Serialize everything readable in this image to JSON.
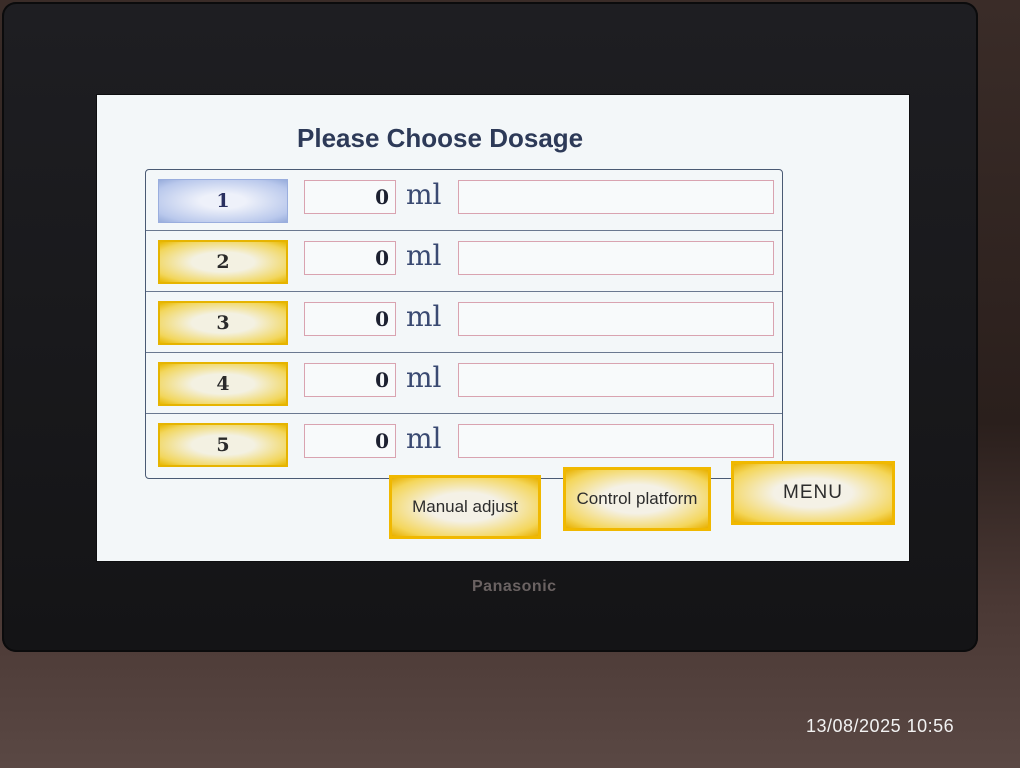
{
  "device": {
    "brand": "Panasonic"
  },
  "screen": {
    "title": "Please Choose Dosage",
    "rows": [
      {
        "number": "1",
        "value": "0",
        "unit": "ml",
        "name": "",
        "selected": true
      },
      {
        "number": "2",
        "value": "0",
        "unit": "ml",
        "name": "",
        "selected": false
      },
      {
        "number": "3",
        "value": "0",
        "unit": "ml",
        "name": "",
        "selected": false
      },
      {
        "number": "4",
        "value": "0",
        "unit": "ml",
        "name": "",
        "selected": false
      },
      {
        "number": "5",
        "value": "0",
        "unit": "ml",
        "name": "",
        "selected": false
      }
    ],
    "buttons": {
      "manual_adjust": "Manual adjust",
      "control_platform": "Control platform",
      "menu": "MENU"
    }
  },
  "photo_timestamp": "13/08/2025 10:56",
  "colors": {
    "button_yellow": "#f0b800",
    "selected_blue": "#b9c8ec",
    "title_text": "#2d3a58"
  }
}
